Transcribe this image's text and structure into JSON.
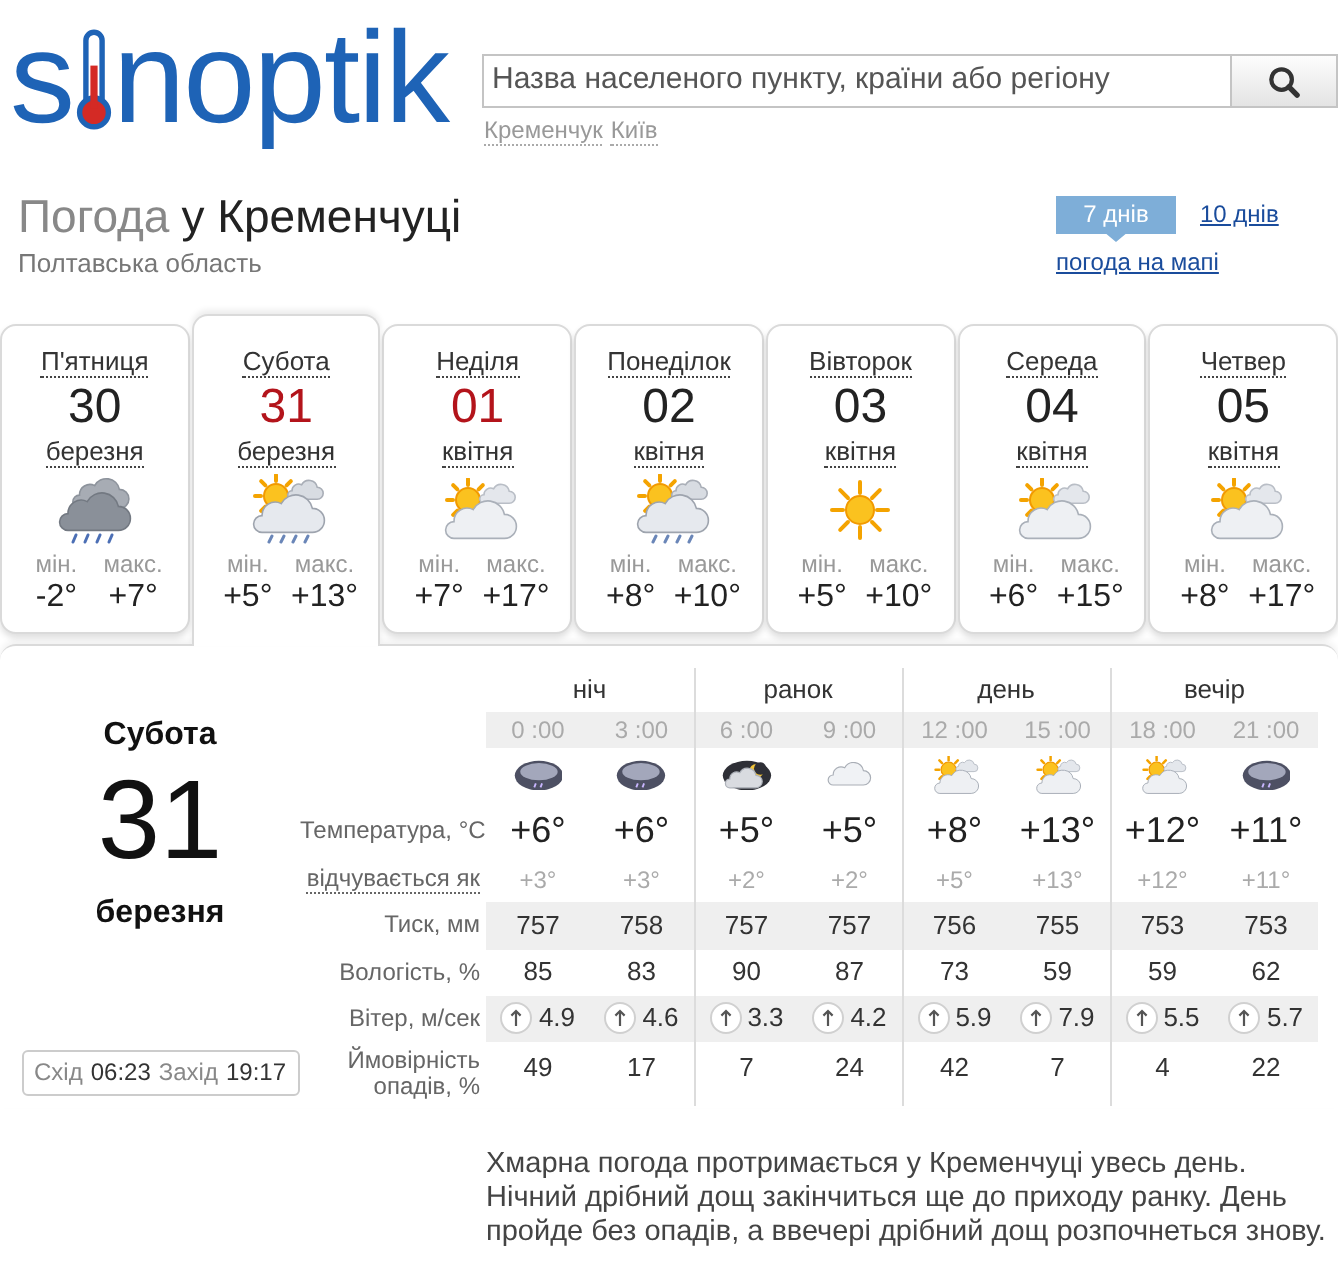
{
  "logo": {
    "parts": [
      "s",
      "noptik"
    ]
  },
  "search": {
    "placeholder": "Назва населеного пункту, країни або регіону"
  },
  "recent_cities": [
    "Кременчук",
    "Київ"
  ],
  "heading": {
    "prefix": "Погода",
    "place": "у Кременчуці",
    "region": "Полтавська область"
  },
  "range_tabs": [
    {
      "label": "7 днів",
      "selected": true
    },
    {
      "label": "10 днів",
      "selected": false
    }
  ],
  "map_link": "погода на мапі",
  "days": [
    {
      "weekday": "П'ятниця",
      "date": "30",
      "month": "березня",
      "weekend": false,
      "selected": false,
      "kind": "rain",
      "min_label": "мін.",
      "min": "-2°",
      "max_label": "макс.",
      "max": "+7°"
    },
    {
      "weekday": "Субота",
      "date": "31",
      "month": "березня",
      "weekend": true,
      "selected": true,
      "kind": "showers",
      "min_label": "мін.",
      "min": "+5°",
      "max_label": "макс.",
      "max": "+13°"
    },
    {
      "weekday": "Неділя",
      "date": "01",
      "month": "квітня",
      "weekend": true,
      "selected": false,
      "kind": "partly",
      "min_label": "мін.",
      "min": "+7°",
      "max_label": "макс.",
      "max": "+17°"
    },
    {
      "weekday": "Понеділок",
      "date": "02",
      "month": "квітня",
      "weekend": false,
      "selected": false,
      "kind": "showers",
      "min_label": "мін.",
      "min": "+8°",
      "max_label": "макс.",
      "max": "+10°"
    },
    {
      "weekday": "Вівторок",
      "date": "03",
      "month": "квітня",
      "weekend": false,
      "selected": false,
      "kind": "sunny",
      "min_label": "мін.",
      "min": "+5°",
      "max_label": "макс.",
      "max": "+10°"
    },
    {
      "weekday": "Середа",
      "date": "04",
      "month": "квітня",
      "weekend": false,
      "selected": false,
      "kind": "partly",
      "min_label": "мін.",
      "min": "+6°",
      "max_label": "макс.",
      "max": "+15°"
    },
    {
      "weekday": "Четвер",
      "date": "05",
      "month": "квітня",
      "weekend": false,
      "selected": false,
      "kind": "partly",
      "min_label": "мін.",
      "min": "+8°",
      "max_label": "макс.",
      "max": "+17°"
    }
  ],
  "detail": {
    "weekday": "Субота",
    "date": "31",
    "month": "березня",
    "sunrise_label": "Схід",
    "sunrise": "06:23",
    "sunset_label": "Захід",
    "sunset": "19:17"
  },
  "row_labels": [
    "Температура, °C",
    "відчувається як",
    "Тиск, мм",
    "Вологість, %",
    "Вітер, м/сек",
    "Ймовірність опадів, %"
  ],
  "periods": [
    {
      "label": "ніч",
      "hours": [
        {
          "time": "0 :00",
          "kind": "overcast",
          "temp": "+6°",
          "feels": "+3°",
          "pressure": "757",
          "humidity": "85",
          "wind": "4.9",
          "precip": "49"
        },
        {
          "time": "3 :00",
          "kind": "overcast",
          "temp": "+6°",
          "feels": "+3°",
          "pressure": "758",
          "humidity": "83",
          "wind": "4.6",
          "precip": "17"
        }
      ]
    },
    {
      "label": "ранок",
      "hours": [
        {
          "time": "6 :00",
          "kind": "night",
          "temp": "+5°",
          "feels": "+2°",
          "pressure": "757",
          "humidity": "90",
          "wind": "3.3",
          "precip": "7"
        },
        {
          "time": "9 :00",
          "kind": "cloudy",
          "temp": "+5°",
          "feels": "+2°",
          "pressure": "757",
          "humidity": "87",
          "wind": "4.2",
          "precip": "24"
        }
      ]
    },
    {
      "label": "день",
      "hours": [
        {
          "time": "12 :00",
          "kind": "partly",
          "temp": "+8°",
          "feels": "+5°",
          "pressure": "756",
          "humidity": "73",
          "wind": "5.9",
          "precip": "42"
        },
        {
          "time": "15 :00",
          "kind": "partly",
          "temp": "+13°",
          "feels": "+13°",
          "pressure": "755",
          "humidity": "59",
          "wind": "7.9",
          "precip": "7"
        }
      ]
    },
    {
      "label": "вечір",
      "hours": [
        {
          "time": "18 :00",
          "kind": "partly",
          "temp": "+12°",
          "feels": "+12°",
          "pressure": "753",
          "humidity": "59",
          "wind": "5.5",
          "precip": "4"
        },
        {
          "time": "21 :00",
          "kind": "overcast",
          "temp": "+11°",
          "feels": "+11°",
          "pressure": "753",
          "humidity": "62",
          "wind": "5.7",
          "precip": "22"
        }
      ]
    }
  ],
  "description": [
    "Хмарна погода протримається у Кременчуці увесь день.",
    "Нічний дрібний дощ закінчиться ще до приходу ранку. День пройде без опадів, а ввечері дрібний дощ розпочнеться знову."
  ]
}
